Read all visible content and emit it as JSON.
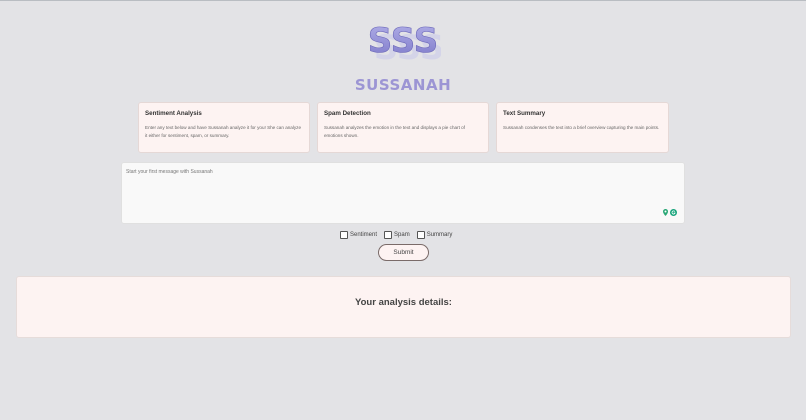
{
  "brand": {
    "logo_text": "SSS",
    "name": "SUSSANAH"
  },
  "cards": [
    {
      "title": "Sentiment Analysis",
      "text": "Enter any text below and have Sussanah analyze it for you! She can analyze it either for sentiment, spam, or summary."
    },
    {
      "title": "Spam Detection",
      "text": "Sussanah analyzes the emotion in the text and displays a pie chart of emotions shown."
    },
    {
      "title": "Text Summary",
      "text": "Sussanah condenses the text into a brief overview capturing the main points."
    }
  ],
  "chat": {
    "placeholder": "Start your first message with Sussanah"
  },
  "options": [
    {
      "label": "Sentiment",
      "checked": false
    },
    {
      "label": "Spam",
      "checked": false
    },
    {
      "label": "Summary",
      "checked": false
    }
  ],
  "submit_label": "Submit",
  "analysis": {
    "title": "Your analysis details:"
  },
  "colors": {
    "background": "#e3e3e6",
    "brand": "#9c95d4",
    "card": "#fdf3f2"
  }
}
